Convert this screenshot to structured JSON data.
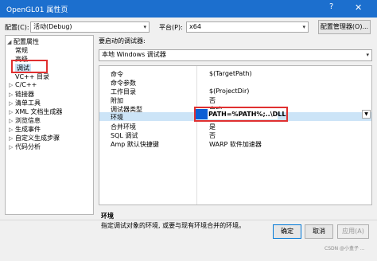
{
  "window": {
    "title": "OpenGL01 属性页",
    "help_glyph": "?",
    "close_glyph": "✕"
  },
  "config_bar": {
    "config_label": "配置(C):",
    "config_value": "活动(Debug)",
    "platform_label": "平台(P):",
    "platform_value": "x64",
    "config_manager_label": "配置管理器(O)..."
  },
  "tree": {
    "root": "配置属性",
    "items": [
      {
        "label": "常规",
        "expandable": false,
        "indent": 1
      },
      {
        "label": "高级",
        "expandable": false,
        "indent": 1
      },
      {
        "label": "调试",
        "expandable": false,
        "indent": 1,
        "selected": true
      },
      {
        "label": "VC++ 目录",
        "expandable": false,
        "indent": 1
      },
      {
        "label": "C/C++",
        "expandable": true,
        "indent": 1
      },
      {
        "label": "链接器",
        "expandable": true,
        "indent": 1
      },
      {
        "label": "清单工具",
        "expandable": true,
        "indent": 1
      },
      {
        "label": "XML 文档生成器",
        "expandable": true,
        "indent": 1
      },
      {
        "label": "浏览信息",
        "expandable": true,
        "indent": 1
      },
      {
        "label": "生成事件",
        "expandable": true,
        "indent": 1
      },
      {
        "label": "自定义生成步骤",
        "expandable": true,
        "indent": 1
      },
      {
        "label": "代码分析",
        "expandable": true,
        "indent": 1
      }
    ]
  },
  "debugger": {
    "heading": "要启动的调试器:",
    "value": "本地 Windows 调试器"
  },
  "properties": [
    {
      "key": "命令",
      "value": "$(TargetPath)"
    },
    {
      "key": "命令参数",
      "value": ""
    },
    {
      "key": "工作目录",
      "value": "$(ProjectDir)"
    },
    {
      "key": "附加",
      "value": "否"
    },
    {
      "key": "调试器类型",
      "value": "自动"
    },
    {
      "key": "环境",
      "value": "PATH=%PATH%;..\\DLL",
      "selected": true
    },
    {
      "key": "合并环境",
      "value": "是"
    },
    {
      "key": "SQL 调试",
      "value": "否"
    },
    {
      "key": "Amp 默认快捷键",
      "value": "WARP 软件加速器"
    }
  ],
  "description": {
    "heading": "环境",
    "text": "指定调试对象的环境, 或要与现有环境合并的环境。"
  },
  "buttons": {
    "ok": "确定",
    "cancel": "取消",
    "apply": "应用(A)"
  },
  "watermark": "CSDN @小盒子 ..."
}
